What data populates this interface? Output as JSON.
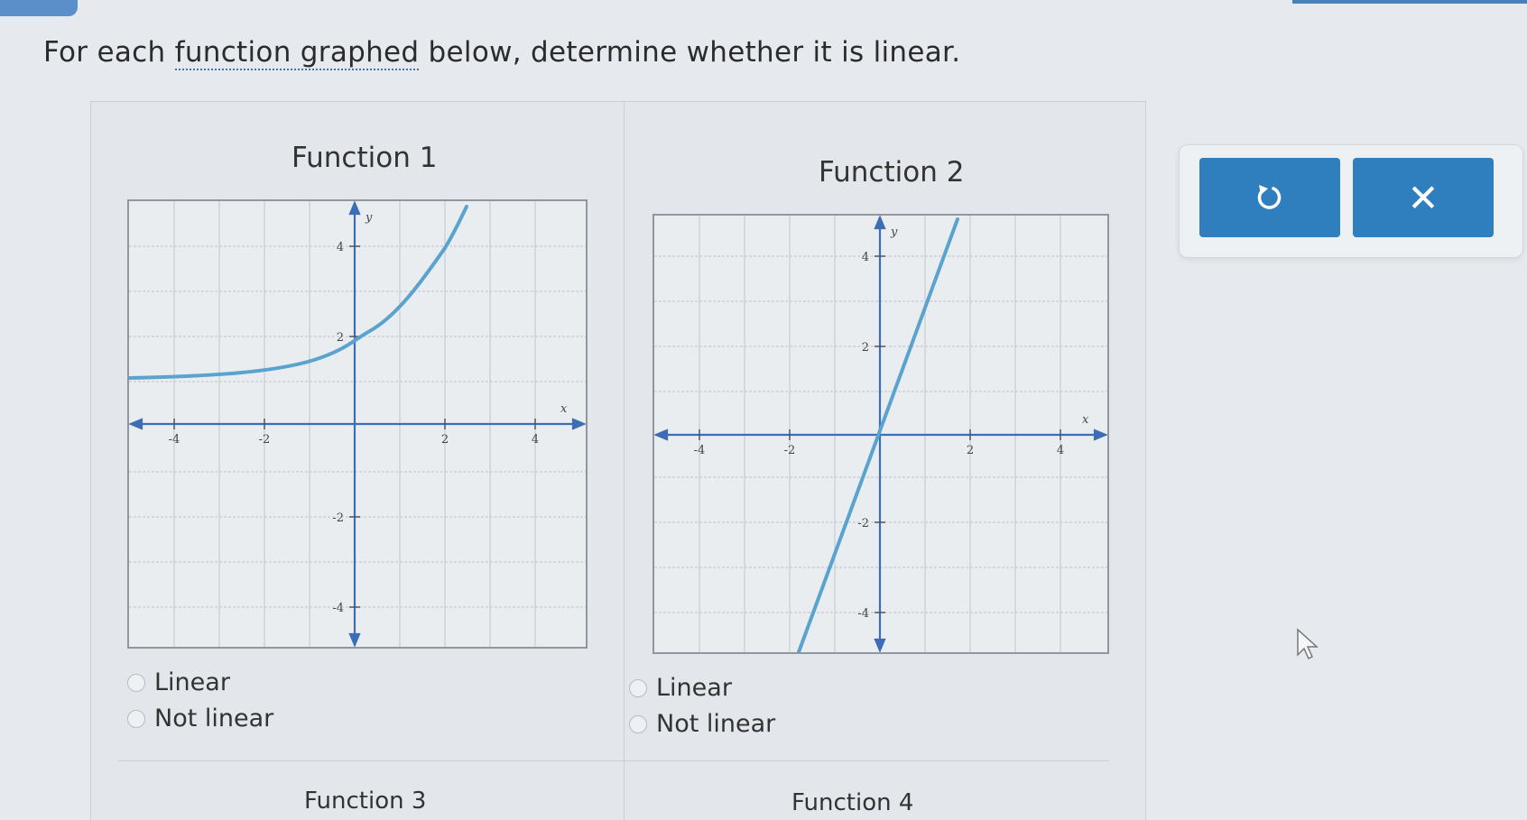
{
  "instruction": {
    "prefix": "For each ",
    "link": "function graphed",
    "suffix": " below, determine whether it is linear."
  },
  "functions": [
    {
      "title": "Function 1",
      "options": [
        "Linear",
        "Not linear"
      ],
      "x_ticks": [
        "-4",
        "-2",
        "2",
        "4"
      ],
      "y_ticks": [
        "4",
        "2",
        "-2",
        "-4"
      ],
      "axis_x": "x",
      "axis_y": "y"
    },
    {
      "title": "Function 2",
      "options": [
        "Linear",
        "Not linear"
      ],
      "x_ticks": [
        "-4",
        "-2",
        "2",
        "4"
      ],
      "y_ticks": [
        "4",
        "2",
        "-2",
        "-4"
      ],
      "axis_x": "x",
      "axis_y": "y"
    }
  ],
  "next_row_titles": [
    "Function 3",
    "Function 4"
  ],
  "buttons": {
    "undo_icon": "undo-icon",
    "close_label": "✕"
  },
  "colors": {
    "curve": "#5aa3cf",
    "axis": "#3d6db5",
    "button": "#2f7fbf"
  }
}
